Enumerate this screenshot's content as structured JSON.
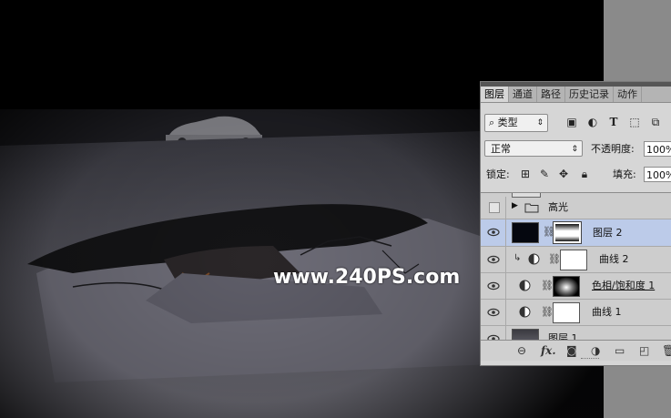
{
  "watermark": "www.240PS.com",
  "panel": {
    "tabs": [
      "图层",
      "通道",
      "路径",
      "历史记录",
      "动作"
    ],
    "active_tab": 0,
    "kind_filter": "类型",
    "blend_mode": "正常",
    "opacity_label": "不透明度:",
    "opacity_value": "100%",
    "lock_label": "锁定:",
    "fill_label": "填充:",
    "fill_value": "100%",
    "layers": [
      {
        "name": "高光",
        "kind": "group",
        "visible": false,
        "selected": false
      },
      {
        "name": "图层 2",
        "kind": "pixel-with-mask",
        "visible": true,
        "selected": true
      },
      {
        "name": "曲线 2",
        "kind": "curves-clipped",
        "visible": true,
        "selected": false
      },
      {
        "name": "色相/饱和度 1",
        "kind": "hue-saturation",
        "visible": true,
        "selected": false
      },
      {
        "name": "曲线 1",
        "kind": "curves",
        "visible": true,
        "selected": false
      },
      {
        "name": "图层 1",
        "kind": "pixel",
        "visible": true,
        "selected": false
      }
    ],
    "footer_icons": [
      "link-icon",
      "fx-icon",
      "mask-icon",
      "adjustment-icon",
      "folder-icon",
      "new-layer-icon",
      "trash-icon"
    ],
    "colors": {
      "selected_row": "#bccbe9",
      "panel_bg": "#d6d6d6"
    }
  }
}
